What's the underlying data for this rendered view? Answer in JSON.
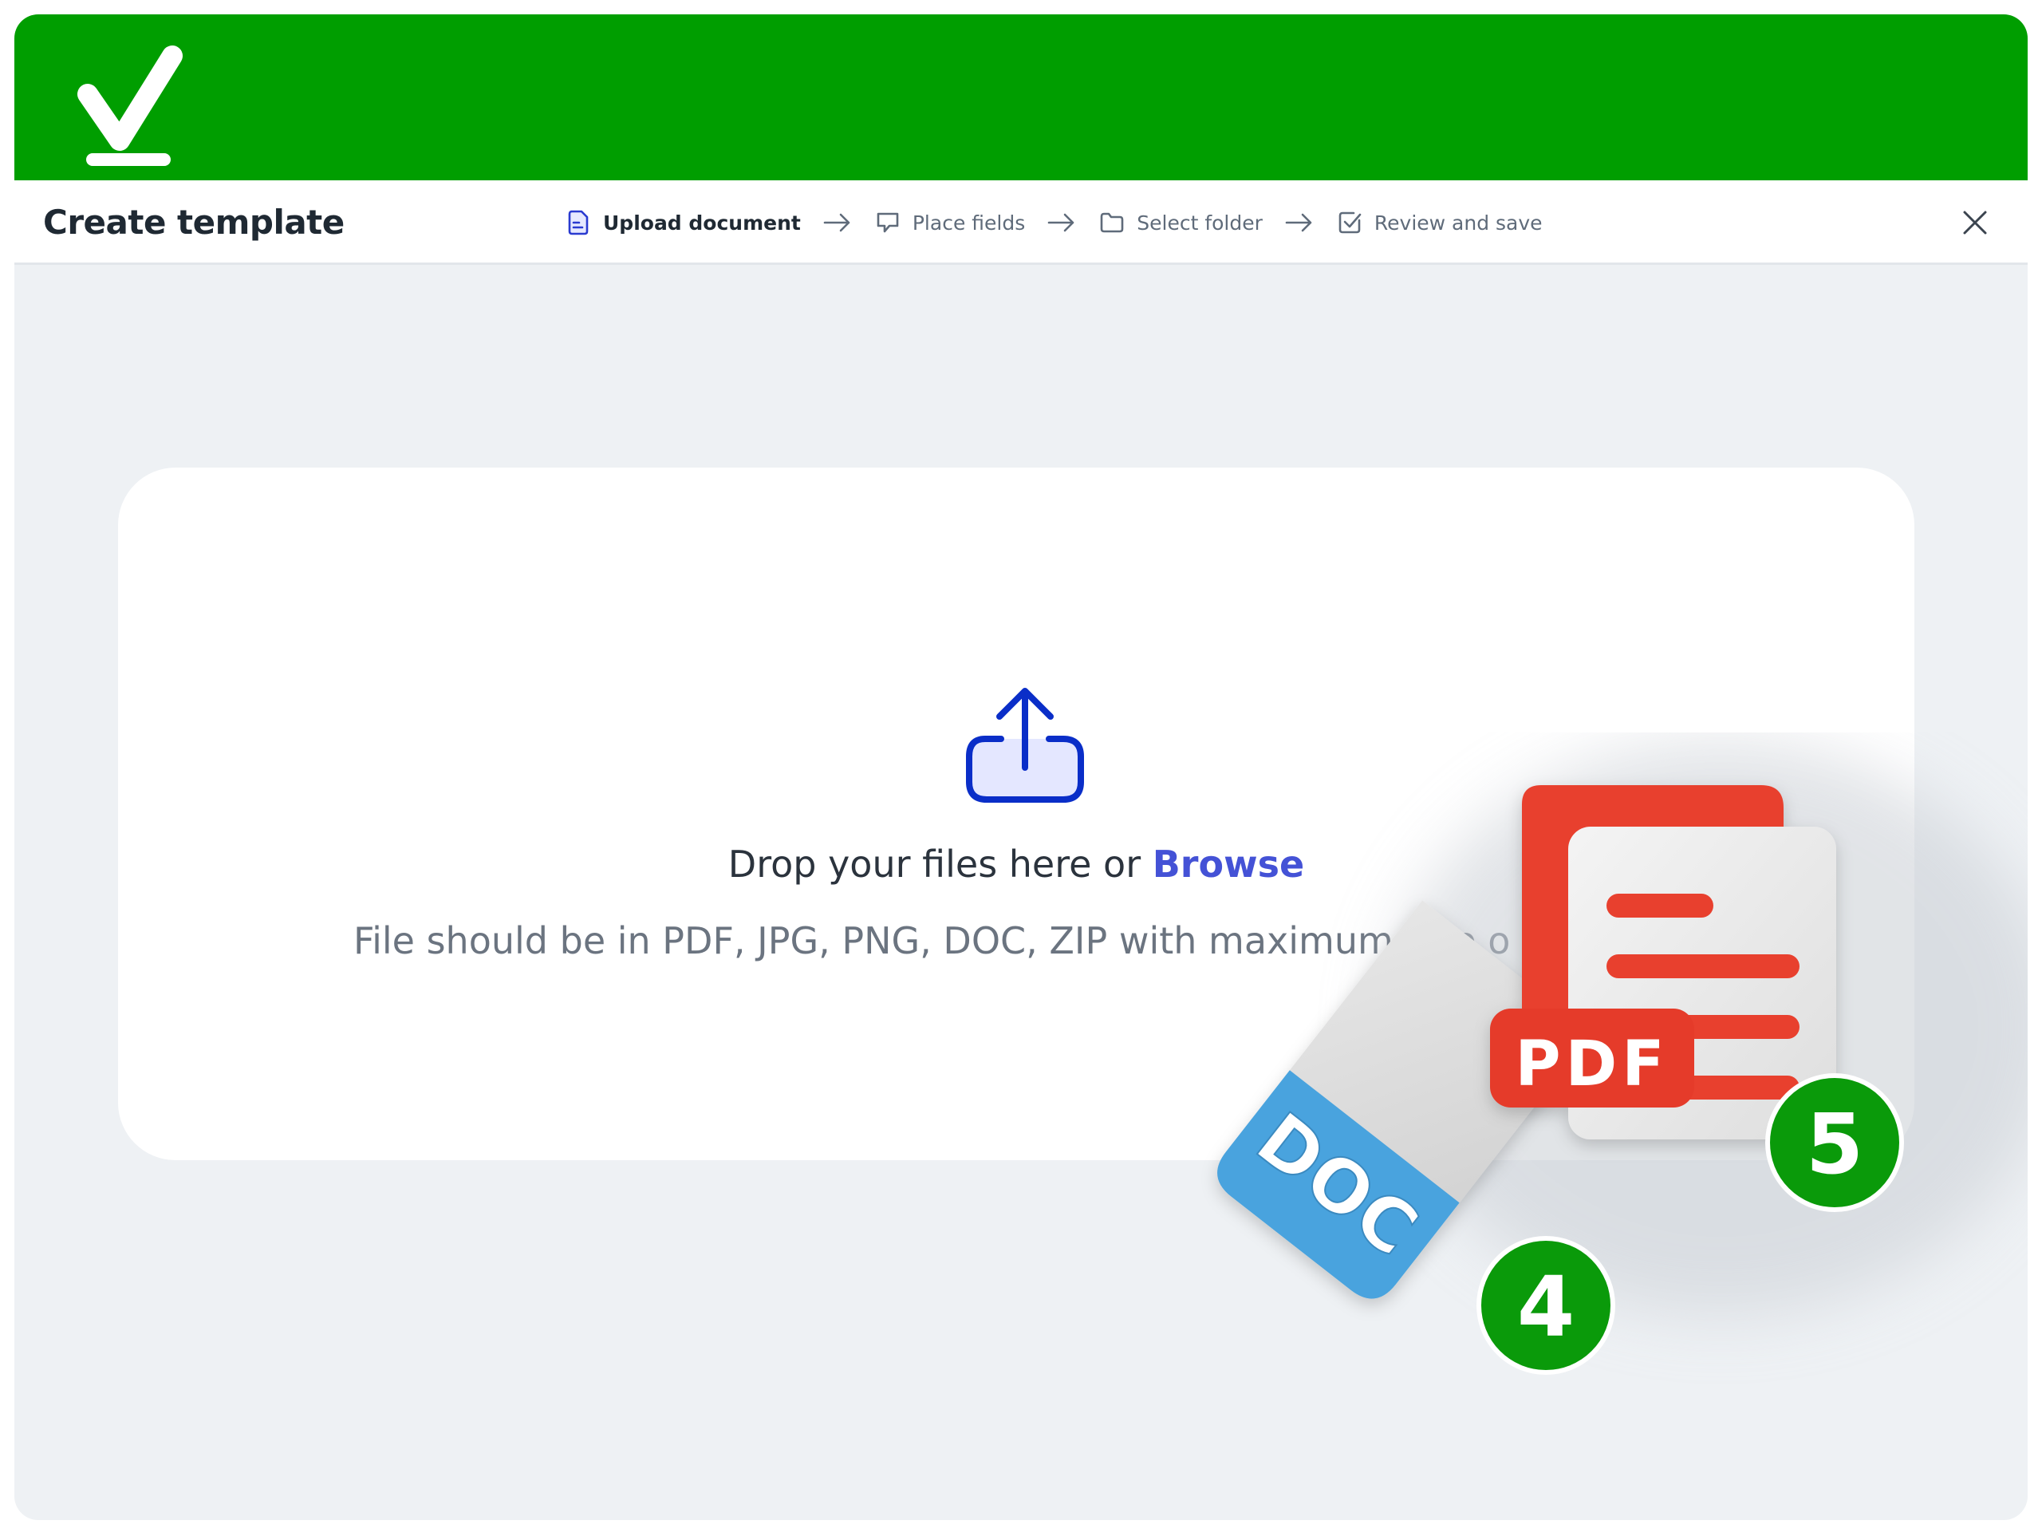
{
  "brand": {
    "bar_color": "#009e00",
    "logo_icon": "checkmark-logo-icon"
  },
  "header": {
    "title": "Create template",
    "close_icon": "close-icon"
  },
  "stepper": {
    "steps": [
      {
        "label": "Upload document",
        "icon": "document-icon",
        "active": true
      },
      {
        "label": "Place fields",
        "icon": "comment-icon",
        "active": false
      },
      {
        "label": "Select folder",
        "icon": "folder-icon",
        "active": false
      },
      {
        "label": "Review and save",
        "icon": "check-square-icon",
        "active": false
      }
    ],
    "separator_icon": "arrow-right-icon",
    "active_color": "#2a3bd0"
  },
  "upload": {
    "icon": "upload-icon",
    "icon_color": "#0a2ec8",
    "drop_text": "Drop your files here or ",
    "browse_label": "Browse",
    "browse_color": "#4452d6",
    "hint_text": "File should be in PDF, JPG, PNG, DOC, ZIP with maximum size o"
  },
  "illustration": {
    "pdf_label": "PDF",
    "pdf_color": "#e8412f",
    "pdf_badge": "5",
    "doc_label": "DOC",
    "doc_color": "#4aa3de",
    "doc_badge": "4",
    "badge_color": "#0a9a0a"
  }
}
